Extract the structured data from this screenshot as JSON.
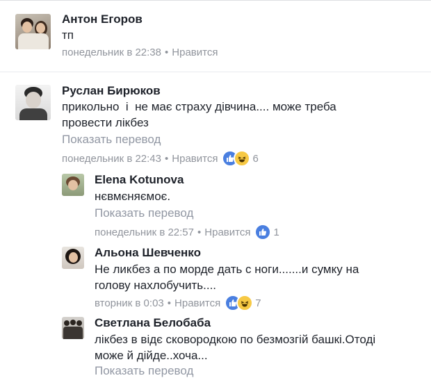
{
  "comments": [
    {
      "name": "Антон Егоров",
      "text": "тп",
      "time": "понедельник в 22:38",
      "like": "Нравится"
    },
    {
      "name": "Руслан Бирюков",
      "text_line1": "прикольно  і  не має страху дівчина.... може треба",
      "text_line2": "провести лікбез",
      "translate": "Показать перевод",
      "time": "понедельник в 22:43",
      "like": "Нравится",
      "reaction_count": "6"
    }
  ],
  "replies": [
    {
      "name": "Elena Kotunova",
      "text": "нєвмєняємоє.",
      "translate": "Показать перевод",
      "time": "понедельник в 22:57",
      "like": "Нравится",
      "reaction_count": "1"
    },
    {
      "name": "Альона Шевченко",
      "text_line1": "Не ликбез а по морде дать с ноги.......и сумку на",
      "text_line2": "голову нахлобучить....",
      "time": "вторник в 0:03",
      "like": "Нравится",
      "reaction_count": "7"
    },
    {
      "name": "Светлана Белобаба",
      "text_line1": "лікбез в відє сковородкою по безмозгій башкі.Отоді",
      "text_line2": "може й дійде..хоча...",
      "translate": "Показать перевод"
    }
  ],
  "separator": "•",
  "colors": {
    "like_blue": "#4a7fe0",
    "haha_yellow": "#f7c944",
    "meta_gray": "#90949c"
  }
}
